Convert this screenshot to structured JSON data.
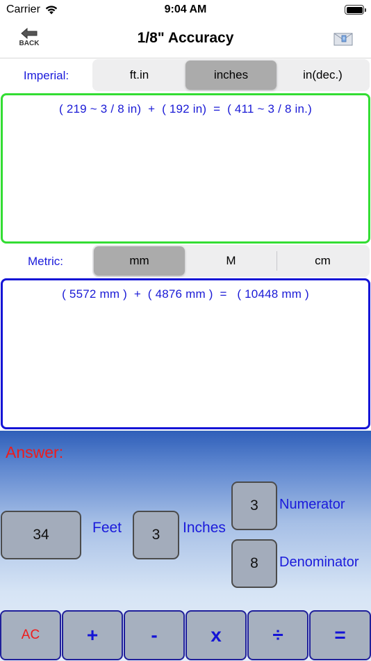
{
  "status_bar": {
    "carrier": "Carrier",
    "time": "9:04 AM"
  },
  "nav": {
    "back_label": "BACK",
    "title": "1/8\" Accuracy",
    "mail_icon": "mail-icon"
  },
  "imperial": {
    "label": "Imperial:",
    "options": [
      "ft.in",
      "inches",
      "in(dec.)"
    ],
    "selected": "inches",
    "result": "( 219 ~ 3 / 8 in)  +  ( 192 in)  =  ( 411 ~ 3 / 8 in.)",
    "border_color": "#33dd33"
  },
  "metric": {
    "label": "Metric:",
    "options": [
      "mm",
      "M",
      "cm"
    ],
    "selected": "mm",
    "result": "( 5572 mm )  +  ( 4876 mm )  =   ( 10448 mm )",
    "border_color": "#1414d6"
  },
  "answer": {
    "label": "Answer:",
    "feet_value": "34",
    "feet_label": "Feet",
    "inches_value": "3",
    "inches_label": "Inches",
    "numerator_value": "3",
    "numerator_label": "Numerator",
    "denominator_value": "8",
    "denominator_label": "Denominator"
  },
  "keypad": {
    "keys": [
      "AC",
      "+",
      "-",
      "x",
      "÷",
      "="
    ]
  },
  "colors": {
    "label_blue": "#1a1adb",
    "answer_red": "#ee1c1c",
    "selected_segment": "#ababab"
  }
}
